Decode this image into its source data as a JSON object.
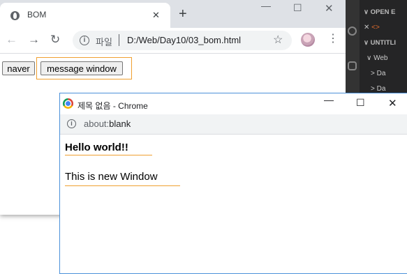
{
  "main_window": {
    "tab_title": "BOM",
    "tab_close": "✕",
    "new_tab": "+",
    "controls": {
      "minimize": "—",
      "maximize": "☐",
      "close": "✕"
    },
    "toolbar": {
      "back": "←",
      "forward": "→",
      "reload": "↻"
    },
    "omnibox": {
      "info": "i",
      "scheme_label": "파일",
      "url": "D:/Web/Day10/03_bom.html",
      "star": "☆"
    },
    "menu": "⋮",
    "page": {
      "naver_button": "naver",
      "message_button": "message window"
    }
  },
  "vscode": {
    "lines": [
      {
        "text": "OPEN E",
        "prefix": "∨",
        "style": "head"
      },
      {
        "text": "",
        "prefix": "✕",
        "file": "<>",
        "style": "file"
      },
      {
        "text": "UNTITLI",
        "prefix": "∨",
        "style": "head"
      },
      {
        "text": "Web",
        "prefix": "∨",
        "style": "item"
      },
      {
        "text": "Da",
        "prefix": ">",
        "style": "item"
      },
      {
        "text": "Da",
        "prefix": ">",
        "style": "item"
      }
    ]
  },
  "popup": {
    "title": "제목 없음 - Chrome",
    "controls": {
      "minimize": "—",
      "maximize": "☐",
      "close": "✕"
    },
    "address": {
      "info": "i",
      "scheme": "about:",
      "path": "blank"
    },
    "heading": "Hello world!!",
    "paragraph": "This is new Window"
  },
  "colors": {
    "highlight": "#f0a030",
    "popup_border": "#4a90d9",
    "vscode_bg": "#252526"
  }
}
